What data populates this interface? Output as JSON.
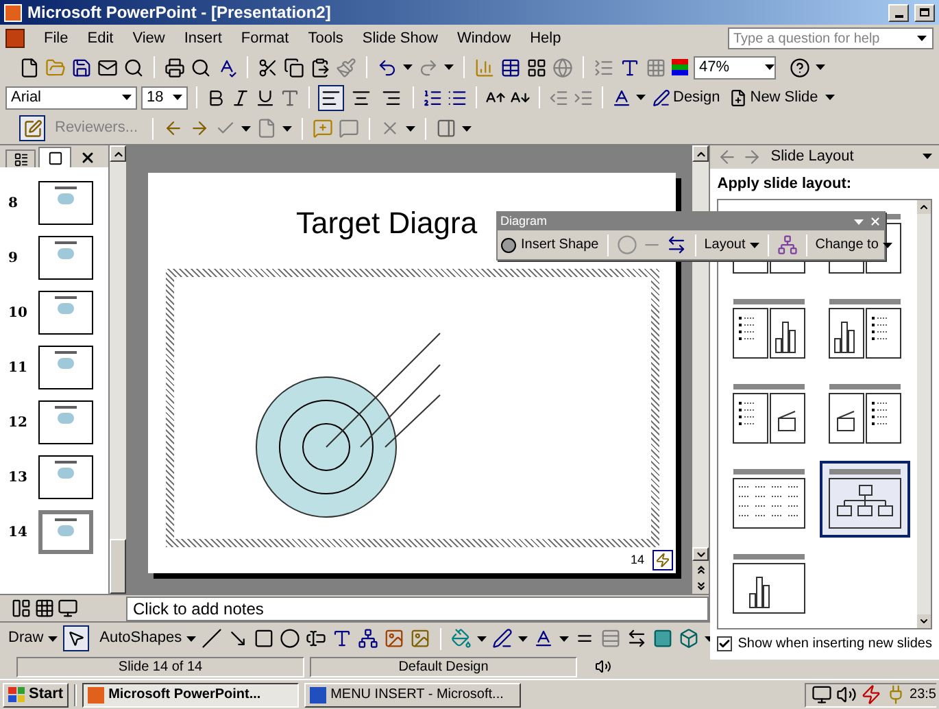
{
  "window": {
    "title": "Microsoft PowerPoint - [Presentation2]"
  },
  "menu": [
    "File",
    "Edit",
    "View",
    "Insert",
    "Format",
    "Tools",
    "Slide Show",
    "Window",
    "Help"
  ],
  "help_box": {
    "placeholder": "Type a question for help"
  },
  "standard_toolbar": {
    "zoom": "47%"
  },
  "formatting_toolbar": {
    "font": "Arial",
    "size": "18",
    "alignments": [
      {
        "kind": "left",
        "selected": true
      },
      {
        "kind": "center",
        "selected": false
      },
      {
        "kind": "right",
        "selected": false
      }
    ],
    "design": "Design",
    "new_slide": "New Slide"
  },
  "reviewing_toolbar": {
    "reviewers": "Reviewers..."
  },
  "slide_panel": {
    "slides": [
      {
        "number": "8",
        "selected": false
      },
      {
        "number": "9",
        "selected": false
      },
      {
        "number": "10",
        "selected": false
      },
      {
        "number": "11",
        "selected": false
      },
      {
        "number": "12",
        "selected": false
      },
      {
        "number": "13",
        "selected": false
      },
      {
        "number": "14",
        "selected": true
      }
    ]
  },
  "slide": {
    "title": "Target Diagra",
    "page_number": "14"
  },
  "diagram_toolbar": {
    "title": "Diagram",
    "insert_shape": "Insert Shape",
    "layout": "Layout",
    "change_to": "Change to"
  },
  "task_pane": {
    "title": "Slide Layout",
    "heading": "Apply slide layout:",
    "layouts": [
      {
        "kind": "two-content",
        "selected": false
      },
      {
        "kind": "text-content",
        "selected": false
      },
      {
        "kind": "text-chart",
        "selected": false
      },
      {
        "kind": "chart-text",
        "selected": false
      },
      {
        "kind": "text-clipart",
        "selected": false
      },
      {
        "kind": "clipart-text",
        "selected": false
      },
      {
        "kind": "table",
        "selected": false
      },
      {
        "kind": "org-chart",
        "selected": true
      },
      {
        "kind": "chart",
        "selected": false
      }
    ],
    "show_option": {
      "label": "Show when inserting new slides",
      "checked": true
    }
  },
  "notes": {
    "text": "Click to add notes"
  },
  "drawing_toolbar": {
    "draw": "Draw",
    "select_tool_selected": true,
    "autoshapes": "AutoShapes"
  },
  "status_bar": [
    "Slide 14 of 14",
    "Default Design"
  ],
  "taskbar": {
    "start": "Start",
    "tasks": [
      {
        "label": "Microsoft PowerPoint...",
        "selected": true
      },
      {
        "label": "MENU INSERT - Microsoft...",
        "selected": false
      }
    ],
    "clock": "23:5"
  }
}
